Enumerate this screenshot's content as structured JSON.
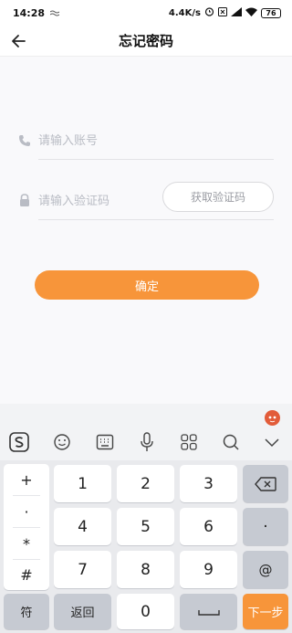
{
  "status_bar": {
    "time": "14:28",
    "speed": "4.4K/s",
    "battery": "76"
  },
  "header": {
    "title": "忘记密码"
  },
  "form": {
    "account_placeholder": "请输入账号",
    "code_placeholder": "请输入验证码",
    "get_code_label": "获取验证码",
    "confirm_label": "确定"
  },
  "keyboard": {
    "symbols": [
      "+",
      "·",
      "*",
      "#"
    ],
    "rows": [
      [
        "1",
        "2",
        "3"
      ],
      [
        "4",
        "5",
        "6"
      ],
      [
        "7",
        "8",
        "9"
      ]
    ],
    "delete_label": "⌫",
    "dot_label": "·",
    "at_label": "@",
    "sym_label": "符",
    "back_label": "返回",
    "zero_label": "0",
    "next_label": "下一步"
  },
  "colors": {
    "accent": "#f7953a",
    "page_bg": "#f9f9fb",
    "placeholder": "#b9bcc4"
  },
  "icons": {
    "status_left": "wave-icon",
    "status_right": [
      "alarm-icon",
      "sim-x-icon",
      "signal-icon",
      "wifi-icon",
      "battery-icon"
    ],
    "header": "back-arrow-icon",
    "form": [
      "phone-icon",
      "lock-icon"
    ],
    "toolbar": [
      "sogou-logo-icon",
      "emoji-icon",
      "keyboard-icon",
      "microphone-icon",
      "grid-icon",
      "search-icon",
      "chevron-down-icon"
    ]
  }
}
